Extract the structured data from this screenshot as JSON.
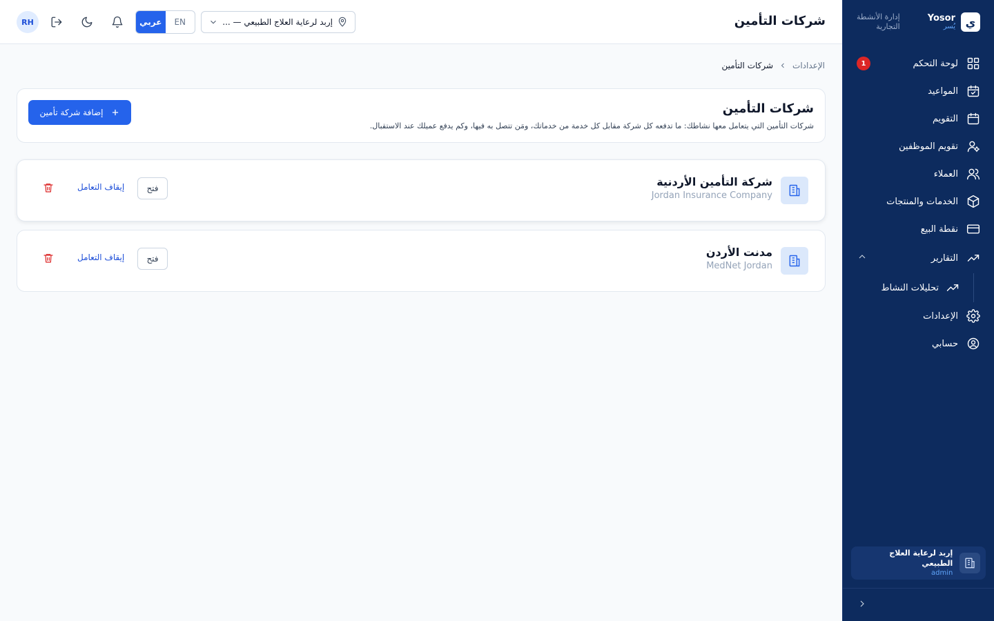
{
  "brand": {
    "name_en": "Yosor",
    "name_ar": "يُسر",
    "tagline_line1": "إدارة الأنشطة",
    "tagline_line2": "التجارية",
    "logo_glyph": "ي"
  },
  "header": {
    "title": "شركات التأمين",
    "avatar_initials": "RH",
    "lang_ar": "عربي",
    "lang_en": "EN",
    "branch_value": "إربد لرعاية العلاج الطبيعي — ..."
  },
  "sidebar": {
    "items": [
      {
        "label": "لوحة التحكم",
        "icon": "dashboard-icon",
        "badge": "1"
      },
      {
        "label": "المواعيد",
        "icon": "calendar-check-icon"
      },
      {
        "label": "التقويم",
        "icon": "calendar-icon"
      },
      {
        "label": "تقويم الموظفين",
        "icon": "user-gear-icon"
      },
      {
        "label": "العملاء",
        "icon": "users-icon"
      },
      {
        "label": "الخدمات والمنتجات",
        "icon": "box-icon"
      },
      {
        "label": "نقطة البيع",
        "icon": "credit-card-icon"
      },
      {
        "label": "التقارير",
        "icon": "trending-up-icon"
      },
      {
        "label": "تحليلات النشاط",
        "icon": "trending-up-icon"
      },
      {
        "label": "الإعدادات",
        "icon": "settings-icon"
      },
      {
        "label": "حسابي",
        "icon": "user-circle-icon"
      }
    ],
    "org_name": "إربد لرعاية العلاج الطبيعي",
    "org_role": "admin"
  },
  "breadcrumb": {
    "parent": "الإعدادات",
    "current": "شركات التأمين"
  },
  "page": {
    "title": "شركات التأمين",
    "description": "شركات التأمين التي يتعامل معها نشاطك: ما تدفعه كل شركة مقابل كل خدمة من خدماتك، ومَن تتصل به فيها، وكم يدفع عميلك عند الاستقبال.",
    "add_button": "إضافة شركة تأمين"
  },
  "insurers": [
    {
      "name_ar": "شركة التأمين الأردنية",
      "name_en": "Jordan Insurance Company",
      "open": "فتح",
      "stop": "إيقاف التعامل"
    },
    {
      "name_ar": "مدنت الأردن",
      "name_en": "MedNet Jordan",
      "open": "فتح",
      "stop": "إيقاف التعامل"
    }
  ],
  "colors": {
    "sidebar_bg": "#0d2b5e",
    "accent": "#2563eb",
    "danger": "#dc2626"
  }
}
